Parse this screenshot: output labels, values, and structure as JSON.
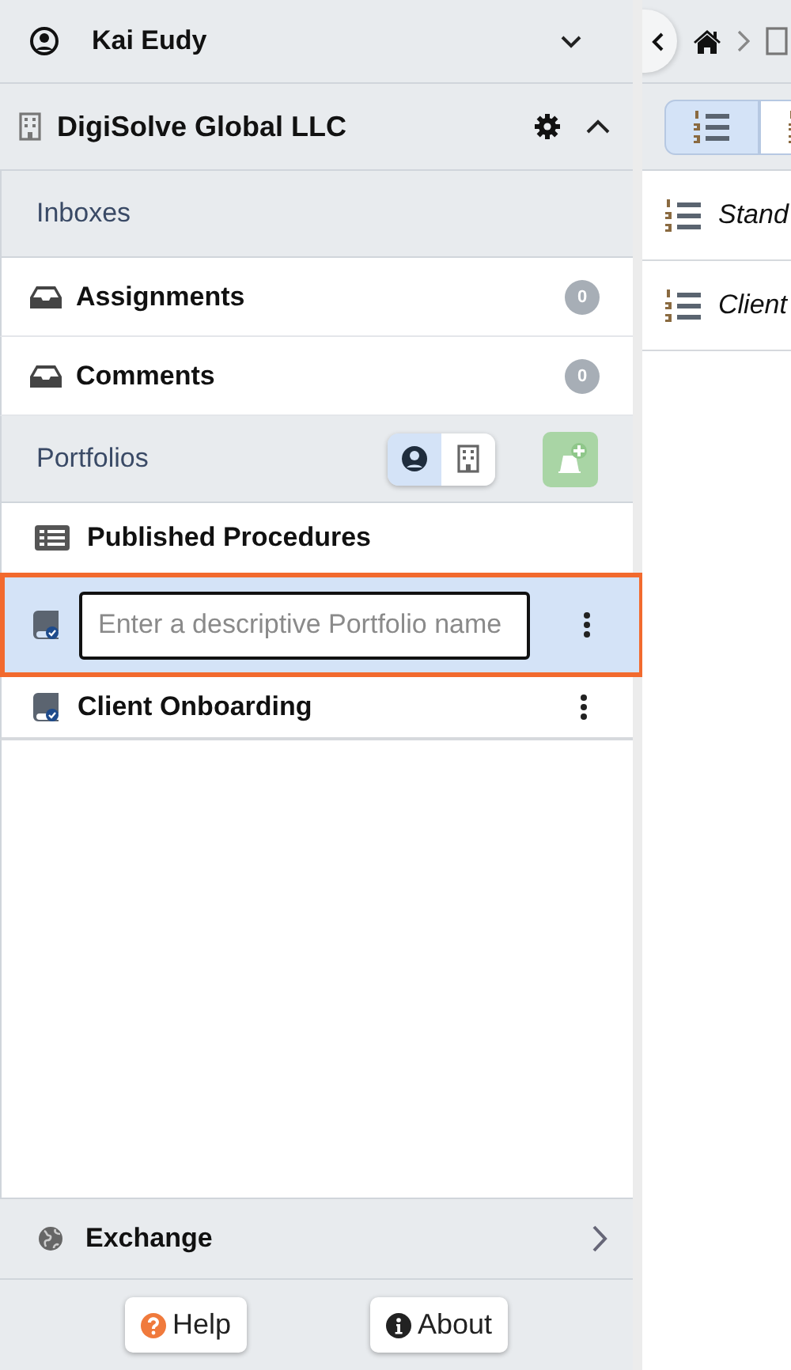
{
  "user": {
    "name": "Kai Eudy"
  },
  "organization": {
    "name": "DigiSolve Global LLC",
    "expanded": true
  },
  "inboxes": {
    "title": "Inboxes",
    "items": [
      {
        "label": "Assignments",
        "count": "0"
      },
      {
        "label": "Comments",
        "count": "0"
      }
    ]
  },
  "portfolios": {
    "title": "Portfolios",
    "scope_toggle": [
      {
        "kind": "personal",
        "selected": true
      },
      {
        "kind": "organization",
        "selected": false
      }
    ],
    "items": [
      {
        "kind": "published",
        "label": "Published Procedures",
        "selected": false
      },
      {
        "kind": "editing",
        "placeholder": "Enter a descriptive Portfolio name",
        "selected": true
      },
      {
        "kind": "portfolio",
        "label": "Client Onboarding",
        "selected": false
      }
    ]
  },
  "exchange": {
    "label": "Exchange"
  },
  "footer_buttons": [
    {
      "kind": "help",
      "label": "Help"
    },
    {
      "kind": "about",
      "label": "About"
    }
  ],
  "content": {
    "view_toggle": [
      {
        "kind": "numbered",
        "selected": true
      },
      {
        "kind": "other",
        "selected": false
      }
    ],
    "items": [
      {
        "label": "Stand"
      },
      {
        "label": "Client"
      }
    ]
  }
}
